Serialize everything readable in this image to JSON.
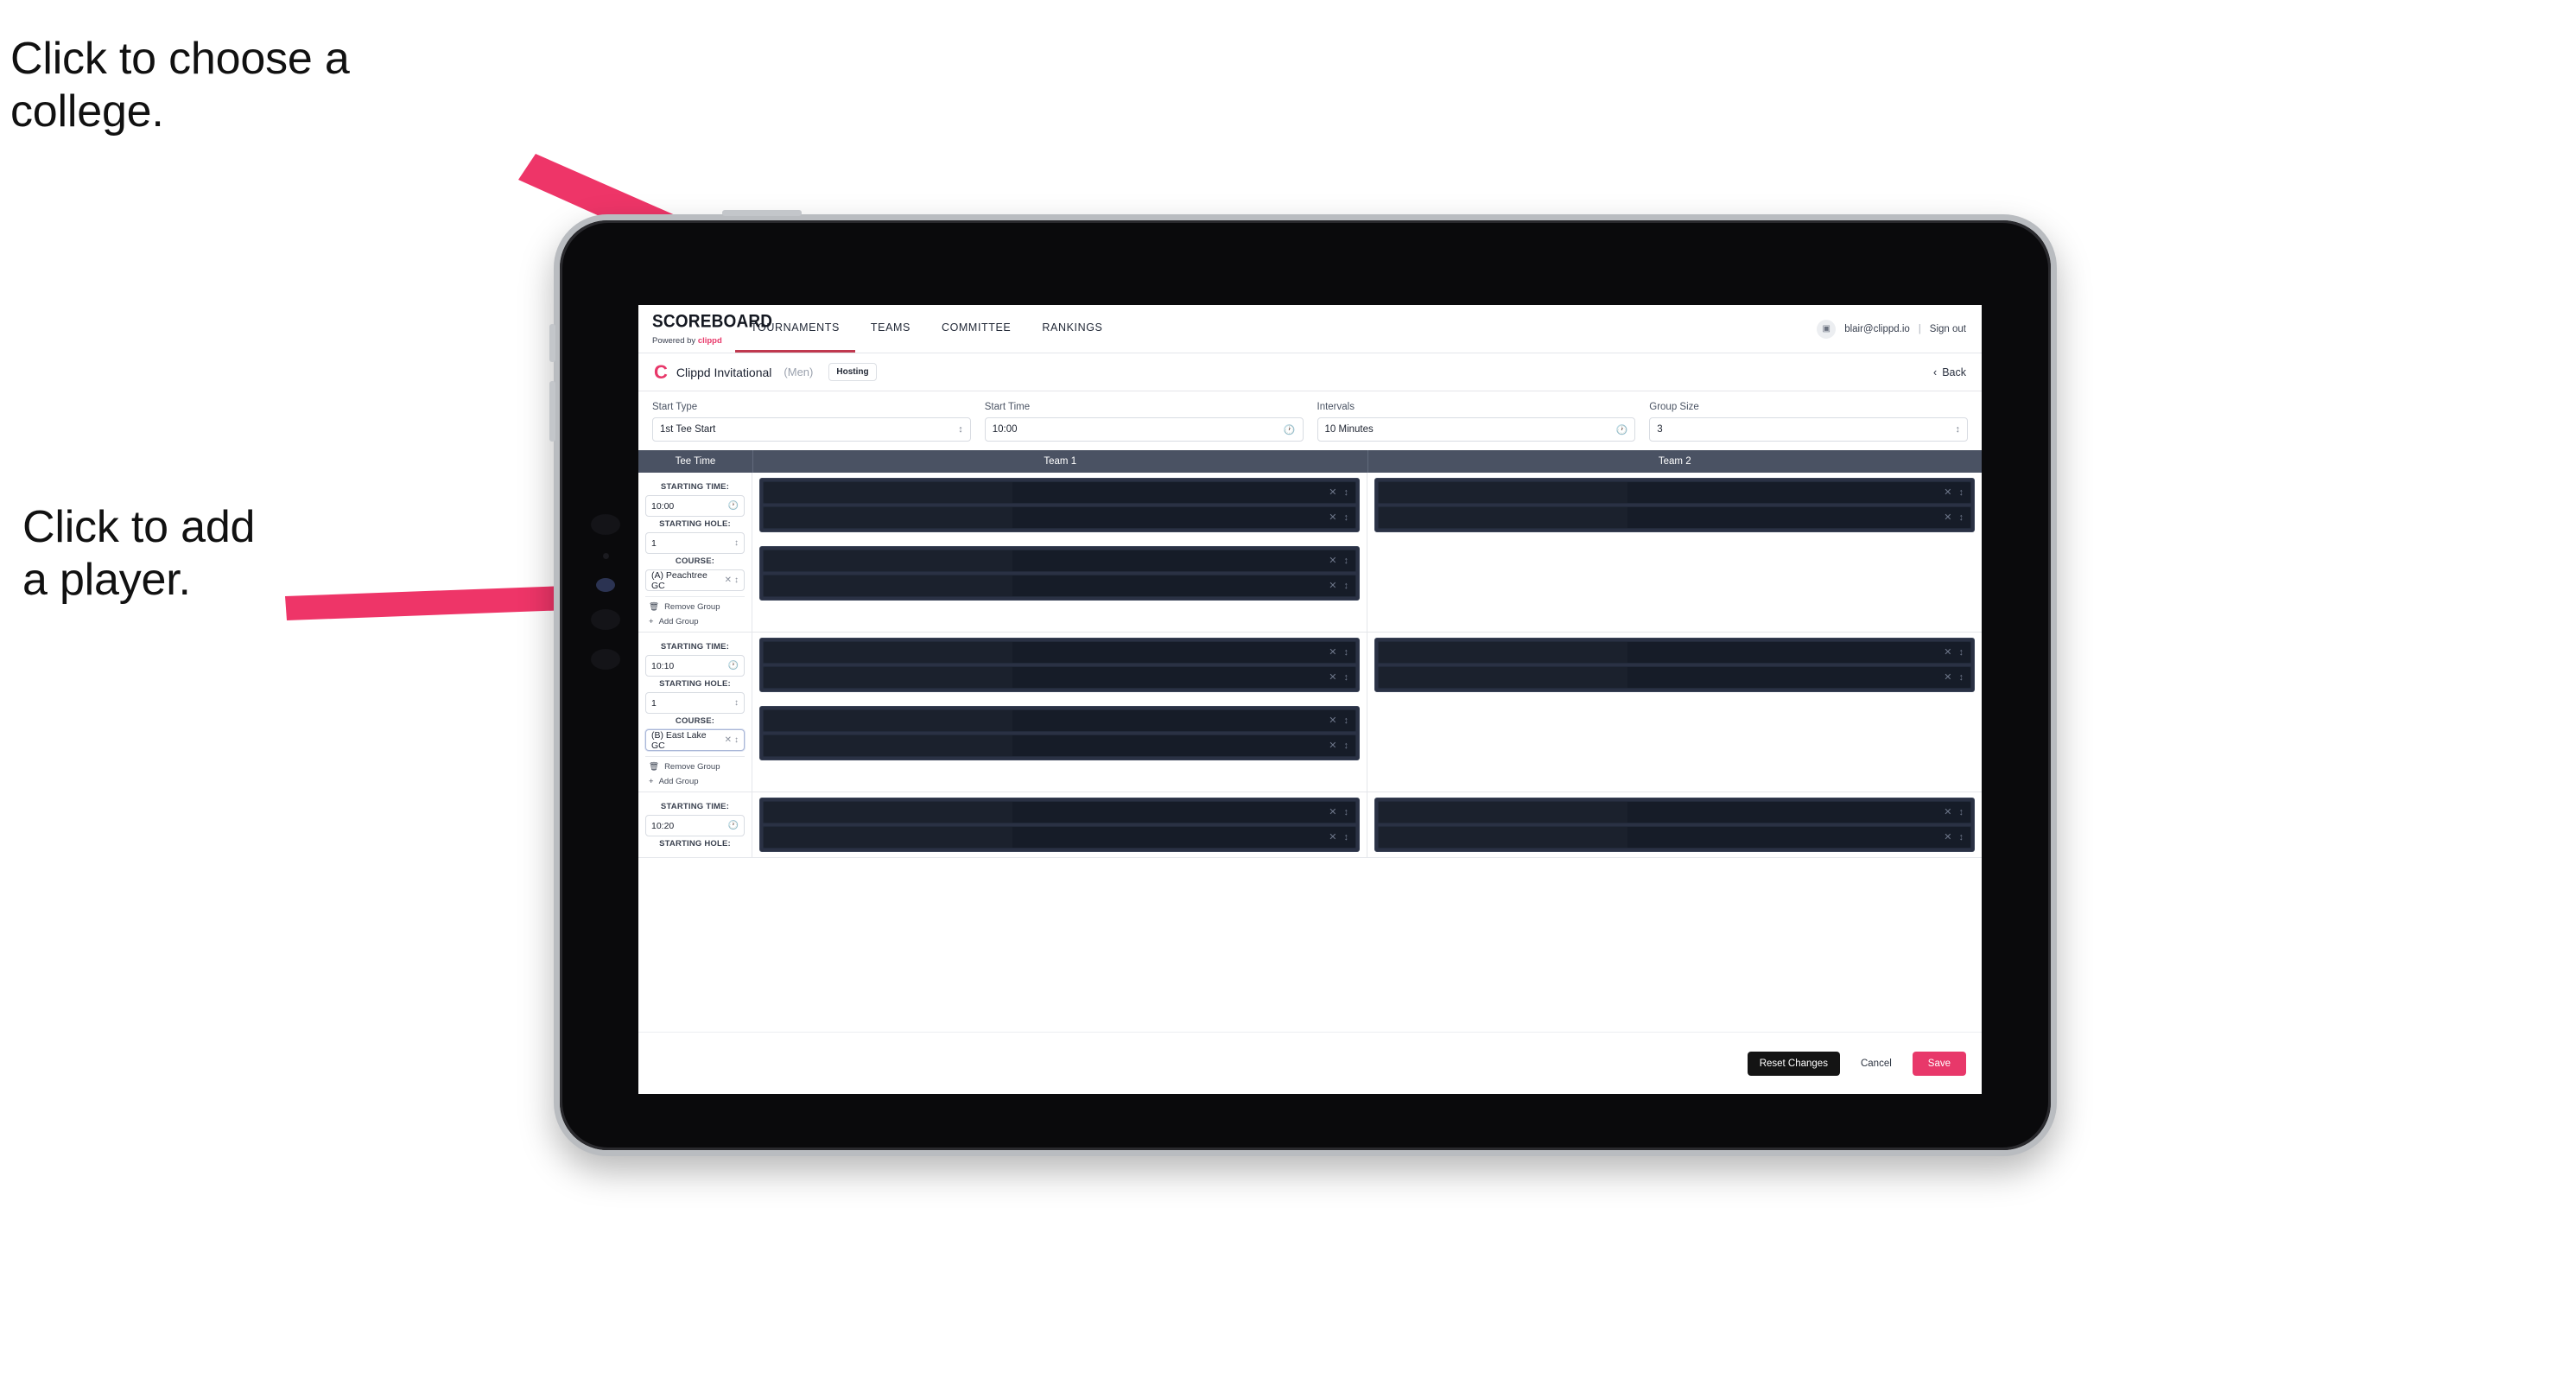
{
  "annotations": {
    "college": "Click to choose a\ncollege.",
    "player": "Click to add\na player.",
    "arrow_color": "#ee3568"
  },
  "topnav": {
    "brand_word": "SCOREBOARD",
    "brand_powered": "Powered by ",
    "brand_clippd": "clippd",
    "tabs": [
      {
        "label": "TOURNAMENTS",
        "active": true
      },
      {
        "label": "TEAMS",
        "active": false
      },
      {
        "label": "COMMITTEE",
        "active": false
      },
      {
        "label": "RANKINGS",
        "active": false
      }
    ],
    "avatar_icon": "user-badge-icon",
    "email": "blair@clippd.io",
    "separator": "|",
    "sign_out": "Sign out"
  },
  "subheader": {
    "logo_letter": "C",
    "tournament_name": "Clippd Invitational",
    "gender": "(Men)",
    "badge": "Hosting",
    "back_label": "Back",
    "back_icon": "chevron-left-icon"
  },
  "controls": [
    {
      "label": "Start Type",
      "value": "1st Tee Start",
      "icon": "stepper-icon"
    },
    {
      "label": "Start Time",
      "value": "10:00",
      "icon": "clock-icon"
    },
    {
      "label": "Intervals",
      "value": "10 Minutes",
      "icon": "clock-icon"
    },
    {
      "label": "Group Size",
      "value": "3",
      "icon": "stepper-icon"
    }
  ],
  "table": {
    "headers": {
      "tee_time": "Tee Time",
      "team_1": "Team 1",
      "team_2": "Team 2"
    },
    "labels": {
      "starting_time": "STARTING TIME:",
      "starting_hole": "STARTING HOLE:",
      "course": "COURSE:",
      "remove_group": "Remove Group",
      "add_group": "Add Group",
      "remove_icon": "trash-icon",
      "add_icon": "plus-icon",
      "clear_icon": "clear-x-icon",
      "stepper_icon": "stepper-icon",
      "clock_icon": "clock-icon"
    },
    "rows": [
      {
        "starting_time": "10:00",
        "starting_hole": "1",
        "course": "(A) Peachtree GC",
        "course_focused": false,
        "team1_groups": [
          {
            "players": [
              "",
              ""
            ]
          },
          {
            "players": [
              "",
              ""
            ]
          }
        ],
        "team2_groups": [
          {
            "players": [
              "",
              ""
            ]
          }
        ]
      },
      {
        "starting_time": "10:10",
        "starting_hole": "1",
        "course": "(B) East Lake GC",
        "course_focused": true,
        "team1_groups": [
          {
            "players": [
              "",
              ""
            ]
          },
          {
            "players": [
              "",
              ""
            ]
          }
        ],
        "team2_groups": [
          {
            "players": [
              "",
              ""
            ]
          }
        ]
      },
      {
        "starting_time": "10:20",
        "starting_hole": "",
        "course": "",
        "course_focused": false,
        "team1_groups": [
          {
            "players": [
              "",
              ""
            ]
          }
        ],
        "team2_groups": [
          {
            "players": [
              "",
              ""
            ]
          }
        ]
      }
    ]
  },
  "footer": {
    "reset_label": "Reset Changes",
    "cancel_label": "Cancel",
    "save_label": "Save",
    "save_color": "#e8386a"
  }
}
